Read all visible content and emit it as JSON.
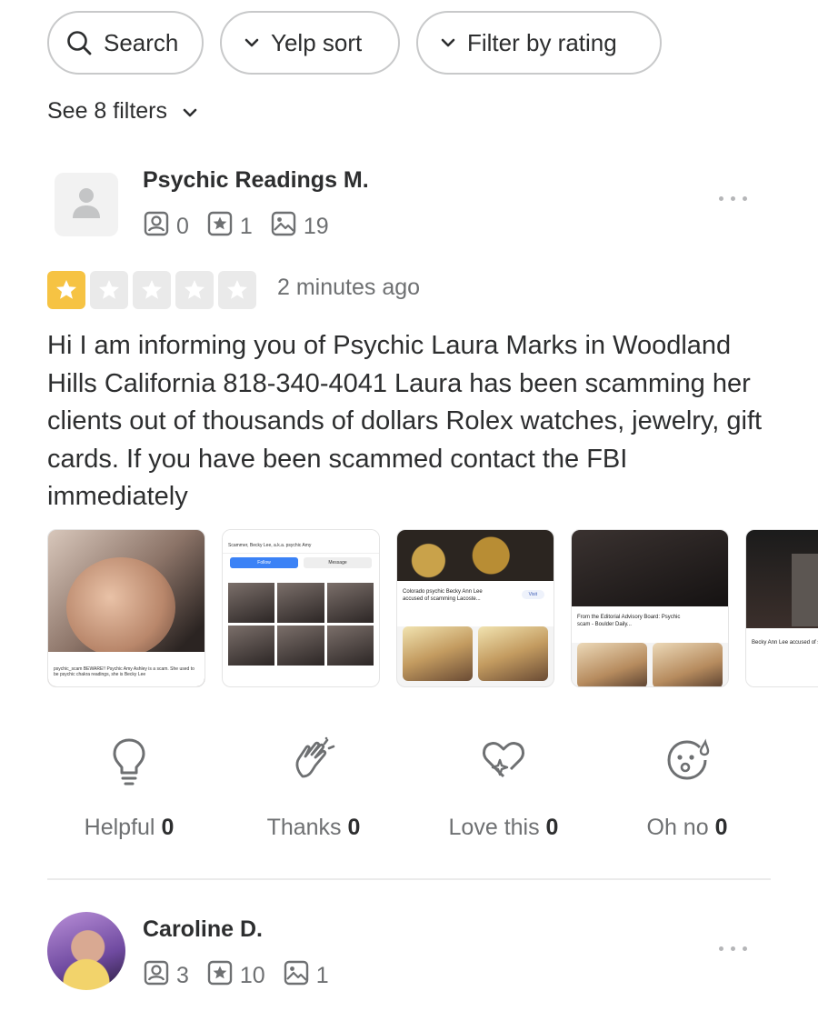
{
  "filters": {
    "search_label": "Search",
    "sort_label": "Yelp sort",
    "rating_label": "Filter by rating",
    "see_filters_label": "See 8 filters"
  },
  "reviews": [
    {
      "name": "Psychic Readings M.",
      "friends": "0",
      "reviews": "1",
      "photos": "19",
      "rating": 1,
      "time_ago": "2 minutes ago",
      "text": "Hi I am informing you of Psychic Laura Marks in Woodland Hills California 818-340-4041 Laura has been scamming her clients out of thousands of dollars Rolex watches, jewelry, gift cards. If you have been scammed contact the FBI immediately",
      "photo_captions": [
        "psychic_scam BEWARE!! Psychic Amy Ashley is a scam. She used to be psychic chakra readings, she is Becky Lee",
        "Scammer, Becky Lee, a.k.a. psychic Amy",
        "Colorado psychic Becky Ann Lee accused of scamming Lacoste...",
        "From the Editorial Advisory Board: Psychic scam - Boulder Daily...",
        "Becky Ann Lee accused of scamming more than"
      ],
      "photo_buttons": {
        "follow": "Follow",
        "message": "Message",
        "visit": "Visit"
      }
    },
    {
      "name": "Caroline D.",
      "friends": "3",
      "reviews": "10",
      "photos": "1"
    }
  ],
  "reactions": [
    {
      "label": "Helpful",
      "count": "0",
      "icon": "lightbulb-icon"
    },
    {
      "label": "Thanks",
      "count": "0",
      "icon": "clapping-hands-icon"
    },
    {
      "label": "Love this",
      "count": "0",
      "icon": "heart-sparkle-icon"
    },
    {
      "label": "Oh no",
      "count": "0",
      "icon": "shocked-face-icon"
    }
  ],
  "colors": {
    "star_active": "#f6c343",
    "star_inactive": "#eaeaea",
    "text_primary": "#2d2e2f",
    "text_secondary": "#6e7072"
  }
}
